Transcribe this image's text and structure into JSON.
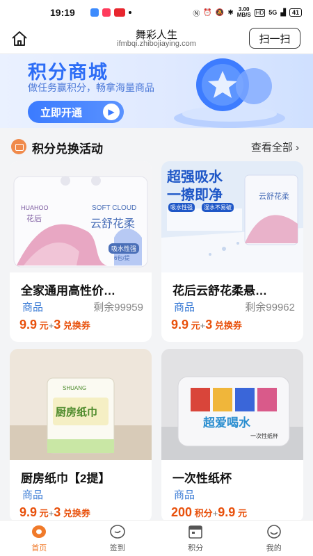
{
  "status": {
    "time": "19:19",
    "speed": "3.00",
    "speed_unit": "MB/S",
    "hd": "HD",
    "network": "5G",
    "battery": "41"
  },
  "header": {
    "title": "舞彩人生",
    "subtitle": "ifmbqi.zhibojiaying.com",
    "scan_label": "扫一扫"
  },
  "banner": {
    "title": "积分商城",
    "desc": "做任务赢积分，畅拿海量商品",
    "button": "立即开通"
  },
  "section": {
    "title": "积分兑换活动",
    "more": "查看全部 ›"
  },
  "products": [
    {
      "name": "全家通用高性价…",
      "tag": "商品",
      "stock": "剩余99959",
      "price_main": "9.9",
      "unit1": "元",
      "plus": "+",
      "price2": "3",
      "unit2": "兑换券",
      "art": {
        "brand": "HUAHOO",
        "brand_cn": "花后",
        "line1": "SOFT CLOUD",
        "line2": "云舒花柔",
        "badge": "吸水性强",
        "count": "6包/提"
      }
    },
    {
      "name": "花后云舒花柔悬…",
      "tag": "商品",
      "stock": "剩余99962",
      "price_main": "9.9",
      "unit1": "元",
      "plus": "+",
      "price2": "3",
      "unit2": "兑换券",
      "art": {
        "headline1": "超强吸水",
        "headline2": "一擦即净",
        "chip1": "吸水性强",
        "chip2": "湿水不易破",
        "brand": "云舒花柔"
      }
    },
    {
      "name": "厨房纸巾【2提】",
      "tag": "商品",
      "stock": "",
      "price_main": "9.9",
      "unit1": "元",
      "plus": "+",
      "price2": "3",
      "unit2": "兑换券",
      "art": {
        "label": "厨房纸巾",
        "brand": "SHUANG"
      }
    },
    {
      "name": "一次性纸杯",
      "tag": "商品",
      "stock": "",
      "price_main": "200",
      "unit1": "积分",
      "plus": "+",
      "price2": "9.9",
      "unit2": "元",
      "art": {
        "label": "超爱喝水",
        "sub": "一次性纸杯"
      }
    }
  ],
  "nav": [
    {
      "label": "首页",
      "icon": "home-icon",
      "active": true
    },
    {
      "label": "签到",
      "icon": "checkin-icon",
      "active": false
    },
    {
      "label": "积分",
      "icon": "calendar-icon",
      "active": false
    },
    {
      "label": "我的",
      "icon": "profile-icon",
      "active": false
    }
  ],
  "colors": {
    "accent": "#f07a2a",
    "price": "#e8500b",
    "tag": "#3a7bd5",
    "banner_blue": "#2d6df6"
  }
}
